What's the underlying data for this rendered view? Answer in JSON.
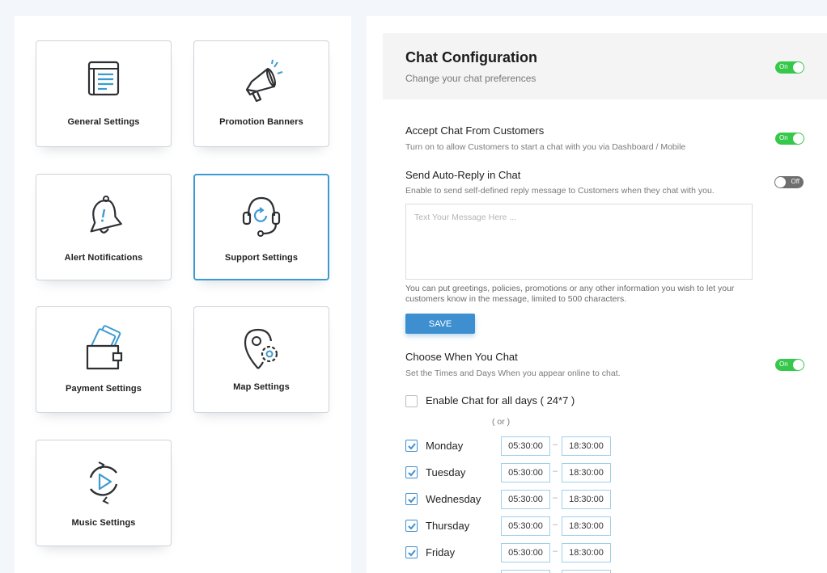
{
  "settings_cards": [
    {
      "label": "General  Settings",
      "icon": "browser-window-icon"
    },
    {
      "label": "Promotion Banners",
      "icon": "megaphone-icon"
    },
    {
      "label": "Alert Notifications",
      "icon": "bell-alert-icon"
    },
    {
      "label": "Support Settings",
      "icon": "headset-icon",
      "selected": true
    },
    {
      "label": "Payment Settings",
      "icon": "wallet-icon"
    },
    {
      "label": "Map  Settings",
      "icon": "map-pin-gear-icon"
    },
    {
      "label": "Music Settings",
      "icon": "play-circle-icon"
    }
  ],
  "chat_config": {
    "title": "Chat Configuration",
    "subtitle": "Change your chat preferences",
    "toggle": "On"
  },
  "accept_chat": {
    "title": "Accept Chat From Customers",
    "subtitle": "Turn on to allow Customers to start a chat with you via Dashboard / Mobile",
    "toggle": "On"
  },
  "auto_reply": {
    "title": "Send Auto-Reply in Chat",
    "subtitle": "Enable to send self-defined reply message to Customers when they chat with you.",
    "toggle": "Off",
    "message_placeholder": "Text Your Message Here ...",
    "hint": "You can put greetings,  policies, promotions or any other information you wish to let your customers know in the message, limited to 500 characters.",
    "save_label": "SAVE"
  },
  "schedule": {
    "title": "Choose When You Chat",
    "subtitle": "Set the Times and Days When you appear online to chat.",
    "toggle": "On",
    "all_days_label": "Enable Chat for all days ( 24*7 )",
    "or_label": "( or )",
    "days": [
      {
        "name": "Monday",
        "checked": true,
        "start": "05:30:00",
        "end": "18:30:00"
      },
      {
        "name": "Tuesday",
        "checked": true,
        "start": "05:30:00",
        "end": "18:30:00"
      },
      {
        "name": "Wednesday",
        "checked": true,
        "start": "05:30:00",
        "end": "18:30:00"
      },
      {
        "name": "Thursday",
        "checked": true,
        "start": "05:30:00",
        "end": "18:30:00"
      },
      {
        "name": "Friday",
        "checked": true,
        "start": "05:30:00",
        "end": "18:30:00"
      }
    ]
  },
  "colors": {
    "accent": "#3d8fd0",
    "toggle_on": "#35c84a",
    "toggle_off": "#6f6f6f",
    "selected_border": "#3d9ad1"
  }
}
